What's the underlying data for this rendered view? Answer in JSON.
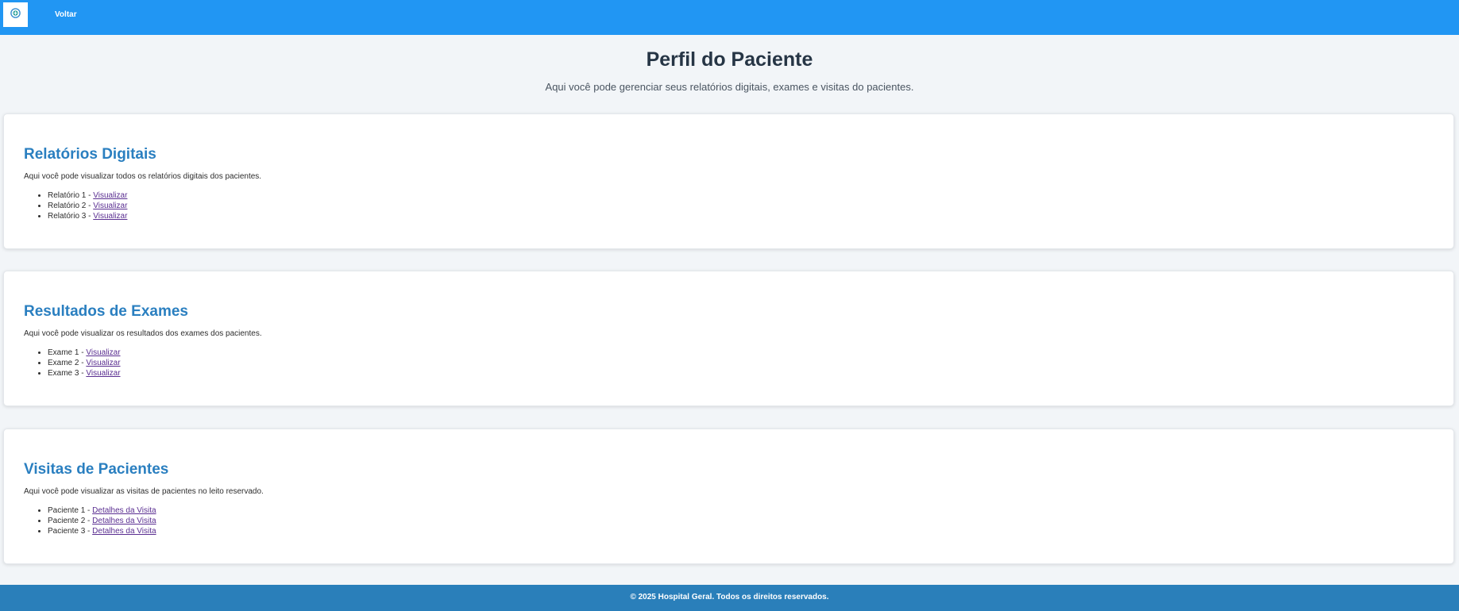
{
  "header": {
    "back_label": "Voltar",
    "logo_icon": "hospital-logo-icon"
  },
  "main": {
    "title": "Perfil do Paciente",
    "subtitle": "Aqui você pode gerenciar seus relatórios digitais, exames e visitas do pacientes."
  },
  "sections": [
    {
      "title": "Relatórios Digitais",
      "description": "Aqui você pode visualizar todos os relatórios digitais dos pacientes.",
      "items": [
        {
          "label": "Relatório 1 - ",
          "link": "Visualizar"
        },
        {
          "label": "Relatório 2 - ",
          "link": "Visualizar"
        },
        {
          "label": "Relatório 3 - ",
          "link": "Visualizar"
        }
      ]
    },
    {
      "title": "Resultados de Exames",
      "description": "Aqui você pode visualizar os resultados dos exames dos pacientes.",
      "items": [
        {
          "label": "Exame 1 - ",
          "link": "Visualizar"
        },
        {
          "label": "Exame 2 - ",
          "link": "Visualizar"
        },
        {
          "label": "Exame 3 - ",
          "link": "Visualizar"
        }
      ]
    },
    {
      "title": "Visitas de Pacientes",
      "description": "Aqui você pode visualizar as visitas de pacientes no leito reservado.",
      "items": [
        {
          "label": "Paciente 1 - ",
          "link": "Detalhes da Visita"
        },
        {
          "label": "Paciente 2 - ",
          "link": "Detalhes da Visita"
        },
        {
          "label": "Paciente 3 - ",
          "link": "Detalhes da Visita"
        }
      ]
    }
  ],
  "footer": {
    "text": "© 2025 Hospital Geral. Todos os direitos reservados."
  },
  "colors": {
    "header_bg": "#2196f3",
    "footer_bg": "#2a7fba",
    "section_title": "#2a7fc0",
    "link": "#5a2e91"
  }
}
